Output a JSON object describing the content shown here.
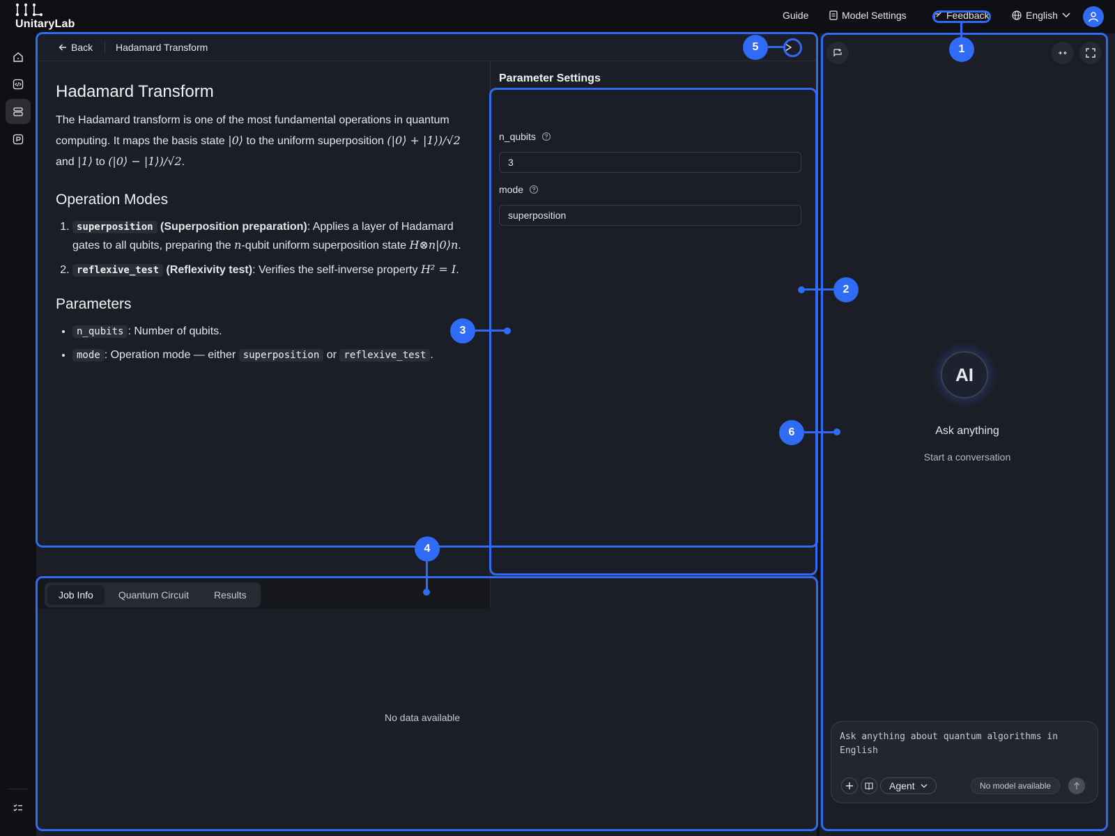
{
  "app": {
    "logo_text": "UnitaryLab",
    "nav": {
      "guide": "Guide",
      "model_settings": "Model Settings",
      "feedback": "Feedback",
      "language": "English"
    }
  },
  "main": {
    "back_label": "Back",
    "breadcrumb_title": "Hadamard Transform",
    "doc": {
      "title": "Hadamard Transform",
      "intro": [
        "The Hadamard transform is one of the most fundamental operations in quantum computing. It maps the basis state ",
        "|0⟩",
        " to the uniform superposition ",
        "(|0⟩ + |1⟩)/√2",
        " and ",
        "|1⟩",
        " to ",
        "(|0⟩ − |1⟩)/√2",
        "."
      ],
      "modes_heading": "Operation Modes",
      "mode1": {
        "code": "superposition",
        "bold": " (Superposition preparation)",
        "text1": ": Applies a layer of Hadamard gates to all qubits, preparing the ",
        "math1": "n",
        "text2": "-qubit uniform superposition state ",
        "math2": "H⊗n|0⟩n",
        "text3": "."
      },
      "mode2": {
        "code": "reflexive_test",
        "bold": " (Reflexivity test)",
        "text1": ": Verifies the self-inverse property ",
        "math1": "H² = I",
        "text2": "."
      },
      "params_heading": "Parameters",
      "param1": {
        "code": "n_qubits",
        "text": ": Number of qubits."
      },
      "param2": {
        "code": "mode",
        "text1": ": Operation mode — either ",
        "code2": "superposition",
        "text2": " or ",
        "code3": "reflexive_test",
        "text3": "."
      }
    },
    "parameter_settings": {
      "title": "Parameter Settings",
      "fields": [
        {
          "label": "n_qubits",
          "value": "3"
        },
        {
          "label": "mode",
          "value": "superposition"
        }
      ]
    },
    "tabs": [
      "Job Info",
      "Quantum Circuit",
      "Results"
    ],
    "active_tab": "Job Info",
    "empty_text": "No data available"
  },
  "chat": {
    "title": "Ask anything",
    "subtitle": "Start a conversation",
    "avatar_text": "AI",
    "input_placeholder": "Ask anything about quantum algorithms in English",
    "agent_label": "Agent",
    "model_label": "No model available"
  },
  "annotations": [
    "1",
    "2",
    "3",
    "4",
    "5",
    "6"
  ],
  "colors": {
    "accent": "#2f6bf5",
    "panel_bg": "#1b1e26",
    "app_bg": "#0f1013"
  }
}
